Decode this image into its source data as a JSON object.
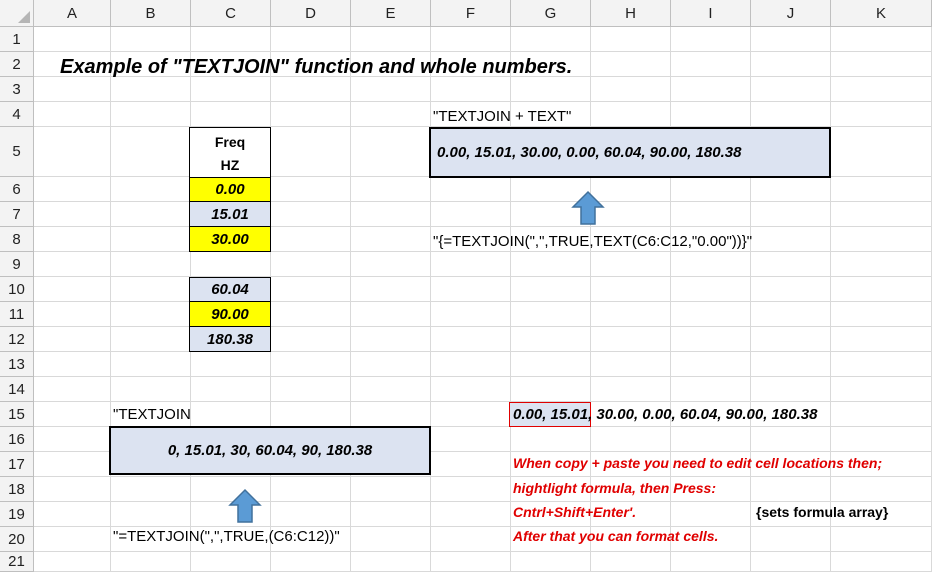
{
  "spreadsheet": {
    "columns": [
      "A",
      "B",
      "C",
      "D",
      "E",
      "F",
      "G",
      "H",
      "I",
      "J",
      "K"
    ],
    "rows": [
      "1",
      "2",
      "3",
      "4",
      "5",
      "6",
      "7",
      "8",
      "9",
      "10",
      "11",
      "12",
      "13",
      "14",
      "15",
      "16",
      "17",
      "18",
      "19",
      "20",
      "21"
    ]
  },
  "title": "Example of \"TEXTJOIN\" function and whole numbers.",
  "freq_header": {
    "line1": "Freq",
    "line2": "HZ"
  },
  "freq_values": [
    "0.00",
    "15.01",
    "30.00",
    "60.04",
    "90.00",
    "180.38"
  ],
  "textjoin_text": {
    "label": "\"TEXTJOIN + TEXT\"",
    "result": "0.00, 15.01, 30.00, 0.00, 60.04, 90.00, 180.38",
    "formula": "\"{=TEXTJOIN(\",\",TRUE,TEXT(C6:C12,\"0.00\"))}\""
  },
  "textjoin_plain": {
    "label": "\"TEXTJOIN",
    "result": "0, 15.01, 30, 60.04, 90, 180.38",
    "formula": "\"=TEXTJOIN(\",\",TRUE,(C6:C12))\""
  },
  "row15_result": {
    "selected_part": "0.00, 15.01",
    "rest": ", 30.00, 0.00, 60.04, 90.00, 180.38"
  },
  "notes": [
    "When copy + paste you need to edit cell locations then;",
    "hightlight formula, then Press:",
    "Cntrl+Shift+Enter'.",
    "After that you can format cells."
  ],
  "array_note": "{sets formula array}",
  "colors": {
    "yellow": "#ffff00",
    "lavender": "#dce3f1",
    "arrow": "#5b9bd5",
    "note_red": "#e00000"
  }
}
